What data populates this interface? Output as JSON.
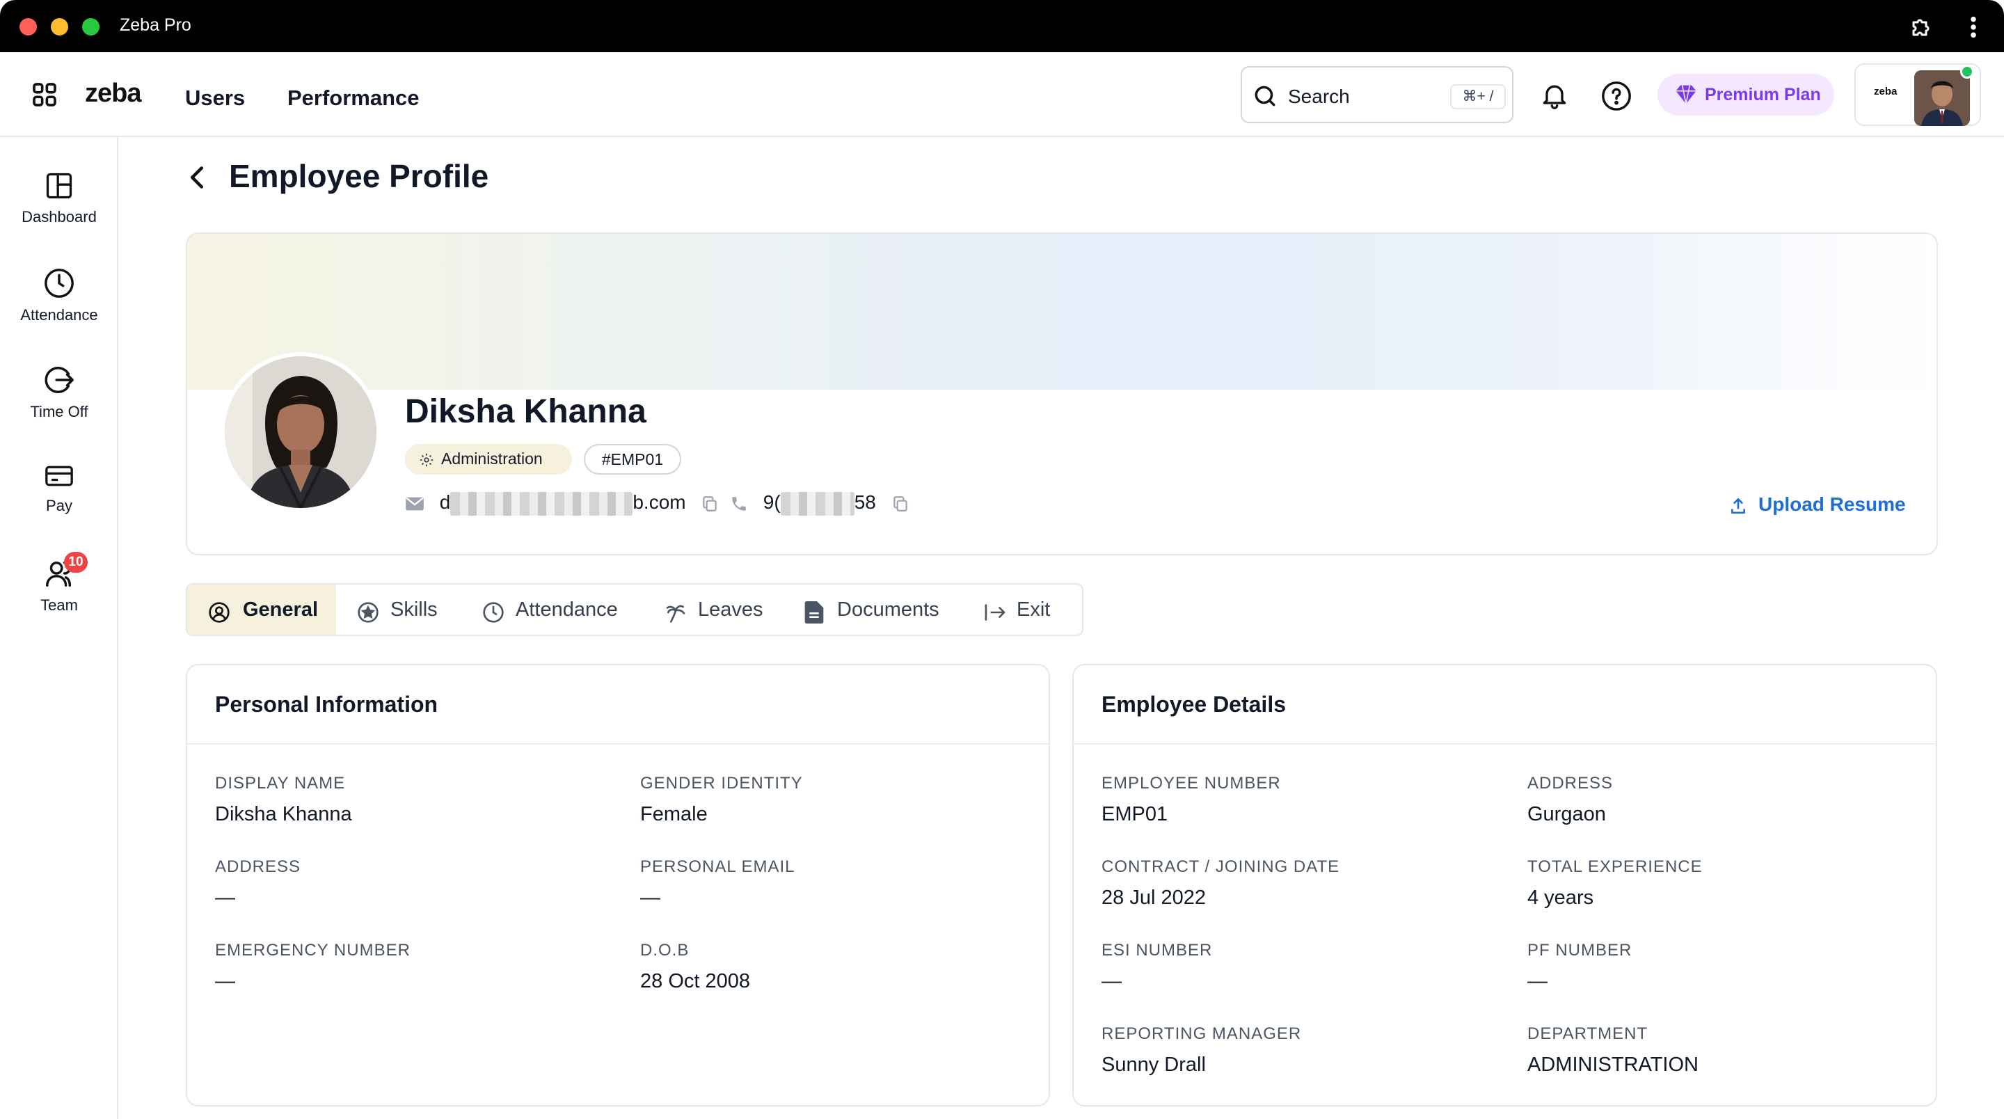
{
  "window": {
    "title": "Zeba Pro"
  },
  "header": {
    "logo": "zeba",
    "nav": [
      "Users",
      "Performance"
    ],
    "search": {
      "label": "Search",
      "shortcut": "⌘+ /"
    },
    "premium_label": "Premium Plan",
    "account_logo": "zeba",
    "online_color": "#22c55e"
  },
  "sidebar": {
    "items": [
      {
        "label": "Dashboard",
        "icon": "dashboard-icon"
      },
      {
        "label": "Attendance",
        "icon": "clock-icon"
      },
      {
        "label": "Time Off",
        "icon": "logout-icon"
      },
      {
        "label": "Pay",
        "icon": "card-icon"
      },
      {
        "label": "Team",
        "icon": "team-icon",
        "badge": "10"
      }
    ]
  },
  "page": {
    "title": "Employee Profile"
  },
  "profile": {
    "name": "Diksha Khanna",
    "department_chip": "Administration",
    "employee_chip": "#EMP01",
    "email_prefix": "d",
    "email_suffix": "b.com",
    "phone_prefix": "9(",
    "phone_suffix": "58",
    "upload_label": "Upload Resume"
  },
  "tabs": [
    {
      "label": "General",
      "icon": "user-circle-icon",
      "active": true
    },
    {
      "label": "Skills",
      "icon": "star-icon"
    },
    {
      "label": "Attendance",
      "icon": "clock-icon"
    },
    {
      "label": "Leaves",
      "icon": "palm-tree-icon"
    },
    {
      "label": "Documents",
      "icon": "document-icon"
    },
    {
      "label": "Exit",
      "icon": "exit-icon"
    }
  ],
  "personal_info": {
    "title": "Personal Information",
    "fields": [
      {
        "label": "DISPLAY NAME",
        "value": "Diksha Khanna"
      },
      {
        "label": "GENDER IDENTITY",
        "value": "Female"
      },
      {
        "label": "ADDRESS",
        "value": "—"
      },
      {
        "label": "PERSONAL EMAIL",
        "value": "—"
      },
      {
        "label": "EMERGENCY NUMBER",
        "value": "—"
      },
      {
        "label": "D.O.B",
        "value": "28 Oct 2008"
      }
    ]
  },
  "employee_details": {
    "title": "Employee Details",
    "fields": [
      {
        "label": "EMPLOYEE NUMBER",
        "value": "EMP01"
      },
      {
        "label": "ADDRESS",
        "value": "Gurgaon"
      },
      {
        "label": "CONTRACT / JOINING DATE",
        "value": "28 Jul 2022"
      },
      {
        "label": "TOTAL EXPERIENCE",
        "value": "4 years"
      },
      {
        "label": "ESI NUMBER",
        "value": "—"
      },
      {
        "label": "PF NUMBER",
        "value": "—"
      },
      {
        "label": "REPORTING MANAGER",
        "value": "Sunny Drall"
      },
      {
        "label": "DEPARTMENT",
        "value": "ADMINISTRATION"
      }
    ]
  },
  "colors": {
    "accent": "#1d6fd8",
    "premium": "#7c3aed",
    "active_tab_bg": "#f5f1dd",
    "badge": "#ef4444"
  }
}
